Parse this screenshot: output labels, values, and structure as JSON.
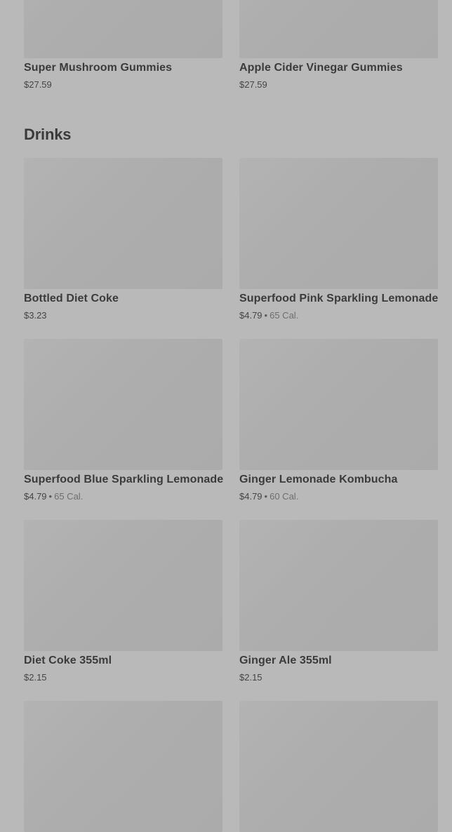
{
  "top_items": [
    {
      "name": "Super Mushroom Gummies",
      "price": "$27.59",
      "cal": ""
    },
    {
      "name": "Apple Cider Vinegar Gummies",
      "price": "$27.59",
      "cal": ""
    }
  ],
  "drinks": {
    "title": "Drinks",
    "items": [
      {
        "name": "Bottled Diet Coke",
        "price": "$3.23",
        "cal": ""
      },
      {
        "name": "Superfood Pink Sparkling Lemonade",
        "price": "$4.79",
        "cal": "65 Cal."
      },
      {
        "name": "Superfood Blue Sparkling Lemonade",
        "price": "$4.79",
        "cal": "65 Cal."
      },
      {
        "name": "Ginger Lemonade Kombucha",
        "price": "$4.79",
        "cal": "60 Cal."
      },
      {
        "name": "Diet Coke 355ml",
        "price": "$2.15",
        "cal": ""
      },
      {
        "name": "Ginger Ale 355ml",
        "price": "$2.15",
        "cal": ""
      },
      {
        "name": "",
        "price": "",
        "cal": ""
      },
      {
        "name": "",
        "price": "",
        "cal": ""
      }
    ]
  }
}
